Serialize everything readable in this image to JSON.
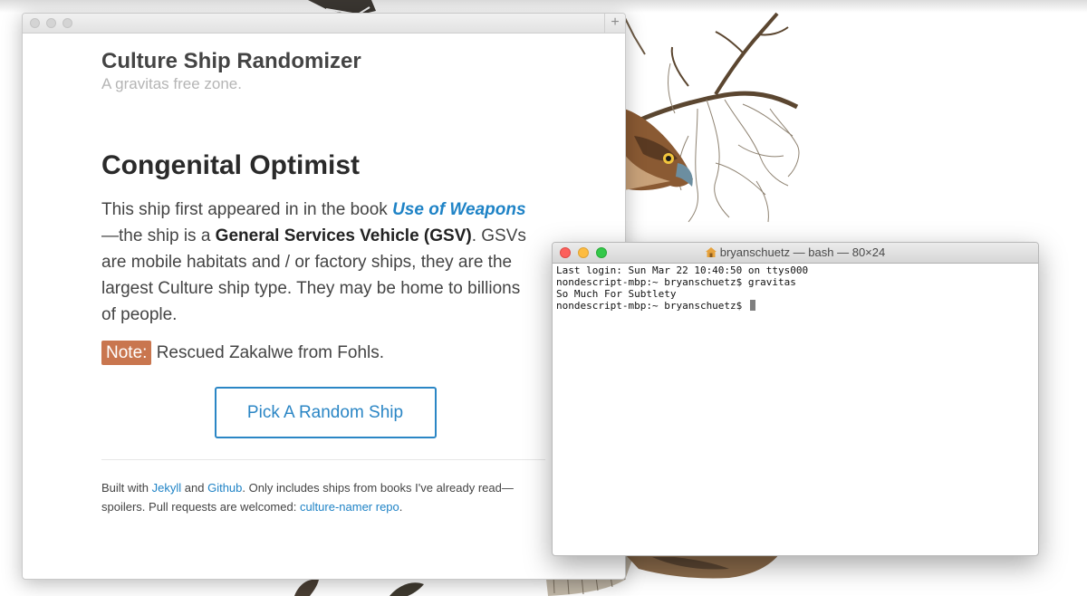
{
  "browser": {
    "site_title": "Culture Ship Randomizer",
    "site_subtitle": "A gravitas free zone.",
    "new_tab_label": "+"
  },
  "ship": {
    "name": "Congenital Optimist",
    "intro": "This ship first appeared in in the book ",
    "book": "Use of Weapons",
    "mid": "—the ship is a ",
    "type": "General Services Vehicle (GSV)",
    "rest": ". GSVs are mobile habitats and / or factory ships, they are the largest Culture ship type. They may be home to billions of people.",
    "note_label": "Note:",
    "note_text": " Rescued Zakalwe from Fohls."
  },
  "button": {
    "label": "Pick A Random Ship"
  },
  "footer": {
    "t1": "Built with ",
    "jekyll": "Jekyll",
    "t2": " and ",
    "github": "Github",
    "t3": ". Only includes ships from books I've already read— spoilers. Pull requests are welcomed: ",
    "repo": "culture-namer repo",
    "t4": "."
  },
  "terminal": {
    "title": "bryanschuetz — bash — 80×24",
    "lines": [
      "Last login: Sun Mar 22 10:40:50 on ttys000",
      "nondescript-mbp:~ bryanschuetz$ gravitas",
      "So Much For Subtlety",
      "nondescript-mbp:~ bryanschuetz$ "
    ]
  },
  "colors": {
    "accent": "#2b86c5",
    "note_badge": "#c9764f",
    "close": "#fc605c",
    "minimize": "#fdbc40",
    "zoom": "#34c84a"
  }
}
